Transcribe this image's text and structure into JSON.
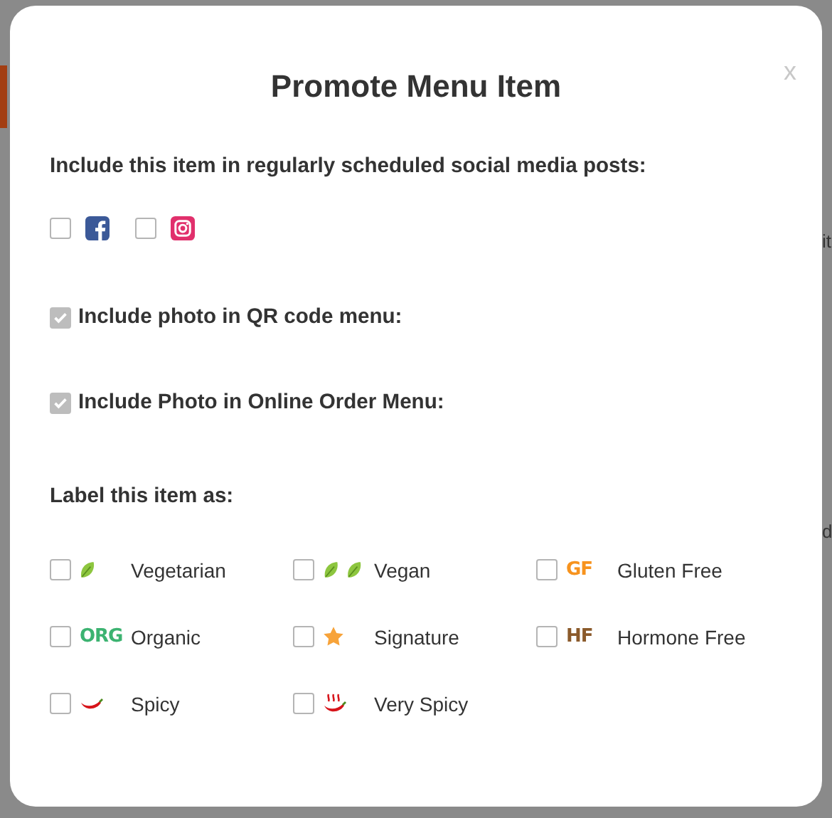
{
  "background": {
    "fragments": [
      "it",
      "d"
    ]
  },
  "dialog": {
    "title": "Promote Menu Item",
    "close": "x",
    "social": {
      "label": "Include this item in regularly scheduled social media posts:",
      "options": [
        {
          "kind": "facebook",
          "checked": false
        },
        {
          "kind": "instagram",
          "checked": false
        }
      ]
    },
    "photo_options": [
      {
        "label": "Include photo in QR code menu:",
        "checked": true,
        "disabled": true
      },
      {
        "label": "Include Photo in Online Order Menu:",
        "checked": true,
        "disabled": true
      }
    ],
    "labels_heading": "Label this item as:",
    "labels": [
      {
        "label": "Vegetarian",
        "kind": "leaf",
        "checked": false
      },
      {
        "label": "Vegan",
        "kind": "double-leaf",
        "checked": false
      },
      {
        "label": "Gluten Free",
        "kind": "badge",
        "badge": "GF",
        "color": "#f7931e",
        "checked": false
      },
      {
        "label": "Organic",
        "kind": "badge",
        "badge": "ORG",
        "color": "#3cb371",
        "checked": false
      },
      {
        "label": "Signature",
        "kind": "star",
        "checked": false
      },
      {
        "label": "Hormone Free",
        "kind": "badge",
        "badge": "HF",
        "color": "#8b5a2b",
        "checked": false
      },
      {
        "label": "Spicy",
        "kind": "chili",
        "checked": false
      },
      {
        "label": "Very Spicy",
        "kind": "hot-chili",
        "checked": false
      }
    ]
  }
}
